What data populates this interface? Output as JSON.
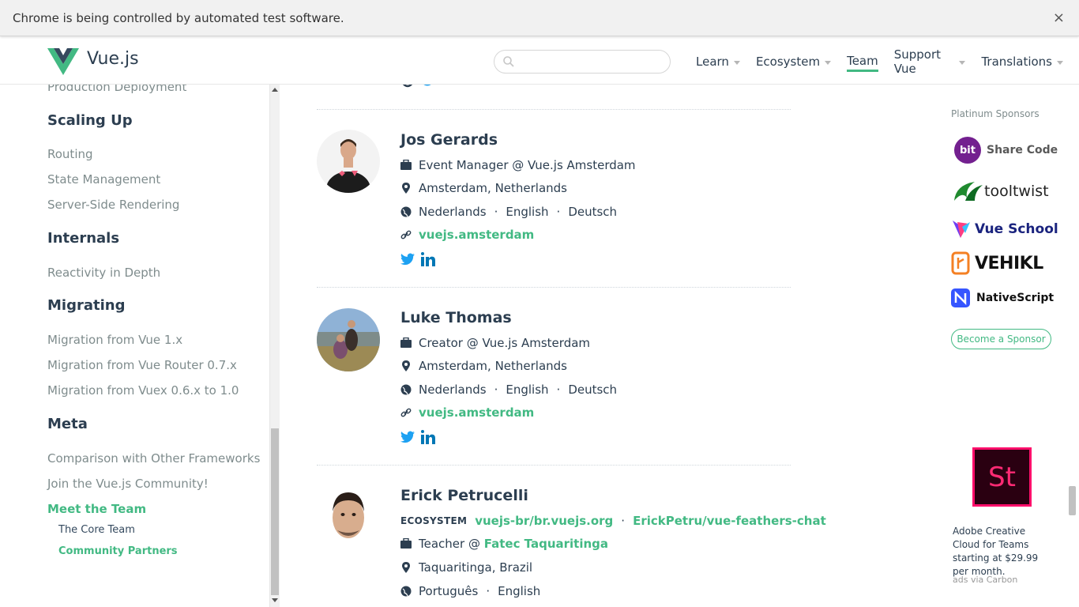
{
  "automation": {
    "message": "Chrome is being controlled by automated test software.",
    "close": "×"
  },
  "header": {
    "logo_text": "Vue.js",
    "search_placeholder": "",
    "nav": [
      {
        "label": "Learn"
      },
      {
        "label": "Ecosystem"
      },
      {
        "label": "Team"
      },
      {
        "label": "Support Vue"
      },
      {
        "label": "Translations"
      }
    ]
  },
  "sidebar": {
    "prev_item": "Production Deployment",
    "sections": [
      {
        "title": "Scaling Up",
        "items": [
          "Routing",
          "State Management",
          "Server-Side Rendering"
        ]
      },
      {
        "title": "Internals",
        "items": [
          "Reactivity in Depth"
        ]
      },
      {
        "title": "Migrating",
        "items": [
          "Migration from Vue 1.x",
          "Migration from Vue Router 0.7.x",
          "Migration from Vuex 0.6.x to 1.0"
        ]
      },
      {
        "title": "Meta",
        "items": [
          "Comparison with Other Frameworks",
          "Join the Vue.js Community!",
          "Meet the Team"
        ]
      }
    ],
    "sub_items": [
      "The Core Team",
      "Community Partners"
    ]
  },
  "members": [
    {
      "name": "Jos Gerards",
      "work": "Event Manager @ Vue.js Amsterdam",
      "location": "Amsterdam, Netherlands",
      "languages": [
        "Nederlands",
        "English",
        "Deutsch"
      ],
      "link": "vuejs.amsterdam"
    },
    {
      "name": "Luke Thomas",
      "work": "Creator @ Vue.js Amsterdam",
      "location": "Amsterdam, Netherlands",
      "languages": [
        "Nederlands",
        "English",
        "Deutsch"
      ],
      "link": "vuejs.amsterdam"
    },
    {
      "name": "Erick Petrucelli",
      "ecosystem_label": "ECOSYSTEM",
      "ecosystem": [
        "vuejs-br/br.vuejs.org",
        "ErickPetru/vue-feathers-chat"
      ],
      "work_prefix": "Teacher @ ",
      "work_link": "Fatec Taquaritinga",
      "location": "Taquaritinga, Brazil",
      "languages": [
        "Português",
        "English"
      ]
    }
  ],
  "sponsors": {
    "title": "Platinum Sponsors",
    "items": [
      "Share Code",
      "tooltwist",
      "Vue School",
      "VEHIKL",
      "NativeScript"
    ],
    "bit_badge": "bit",
    "become": "Become a Sponsor"
  },
  "ad": {
    "badge": "St",
    "text": "Adobe Creative Cloud for Teams starting at $29.99 per month.",
    "via": "ads via Carbon"
  },
  "colors": {
    "accent": "#42b983",
    "text": "#2c3e50",
    "muted": "#7f8c8d",
    "twitter": "#1da1f2",
    "linkedin": "#0077b5"
  }
}
